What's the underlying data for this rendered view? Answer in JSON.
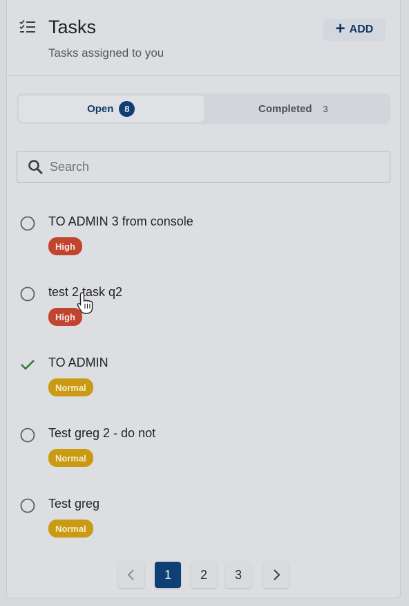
{
  "header": {
    "title": "Tasks",
    "subtitle": "Tasks assigned to you",
    "icon": "checklist-icon",
    "add_label": "ADD",
    "add_icon": "plus-icon"
  },
  "tabs": [
    {
      "label": "Open",
      "count": "8",
      "active": true
    },
    {
      "label": "Completed",
      "count": "3",
      "active": false
    }
  ],
  "search": {
    "placeholder": "Search",
    "value": "",
    "icon": "search-icon"
  },
  "tasks": [
    {
      "title": "TO ADMIN 3 from console",
      "priority": "High",
      "completed": false
    },
    {
      "title": "test 2 task q2",
      "priority": "High",
      "completed": false
    },
    {
      "title": "TO ADMIN",
      "priority": "Normal",
      "completed": true
    },
    {
      "title": "Test greg 2 - do not",
      "priority": "Normal",
      "completed": false
    },
    {
      "title": "Test greg",
      "priority": "Normal",
      "completed": false
    }
  ],
  "pagination": {
    "pages": [
      "1",
      "2",
      "3"
    ],
    "current": "1",
    "prev_icon": "chevron-left-icon",
    "next_icon": "chevron-right-icon"
  },
  "colors": {
    "primary": "#0f3f74",
    "high": "#c0442e",
    "normal": "#c99a12",
    "done_check": "#2e7d32"
  }
}
